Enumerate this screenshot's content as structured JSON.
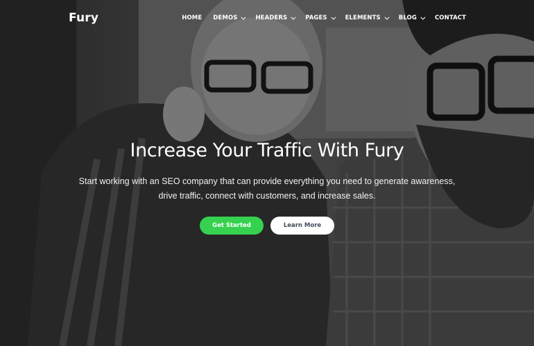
{
  "brand": {
    "logo_text": "Fury"
  },
  "nav": {
    "items": [
      {
        "label": "HOME",
        "has_dropdown": false
      },
      {
        "label": "DEMOS",
        "has_dropdown": true
      },
      {
        "label": "HEADERS",
        "has_dropdown": true
      },
      {
        "label": "PAGES",
        "has_dropdown": true
      },
      {
        "label": "ELEMENTS",
        "has_dropdown": true
      },
      {
        "label": "BLOG",
        "has_dropdown": true
      },
      {
        "label": "CONTACT",
        "has_dropdown": false
      }
    ]
  },
  "hero": {
    "title": "Increase Your Traffic With Fury",
    "subtitle": "Start working with an SEO company that can provide everything you need to generate awareness, drive traffic, connect with customers, and increase sales.",
    "primary_button": "Get Started",
    "secondary_button": "Learn More"
  },
  "colors": {
    "accent_green": "#35d14f",
    "text_white": "#ffffff",
    "button_secondary_text": "#444a5c"
  },
  "icons": {
    "dropdown": "chevron-down-icon"
  }
}
